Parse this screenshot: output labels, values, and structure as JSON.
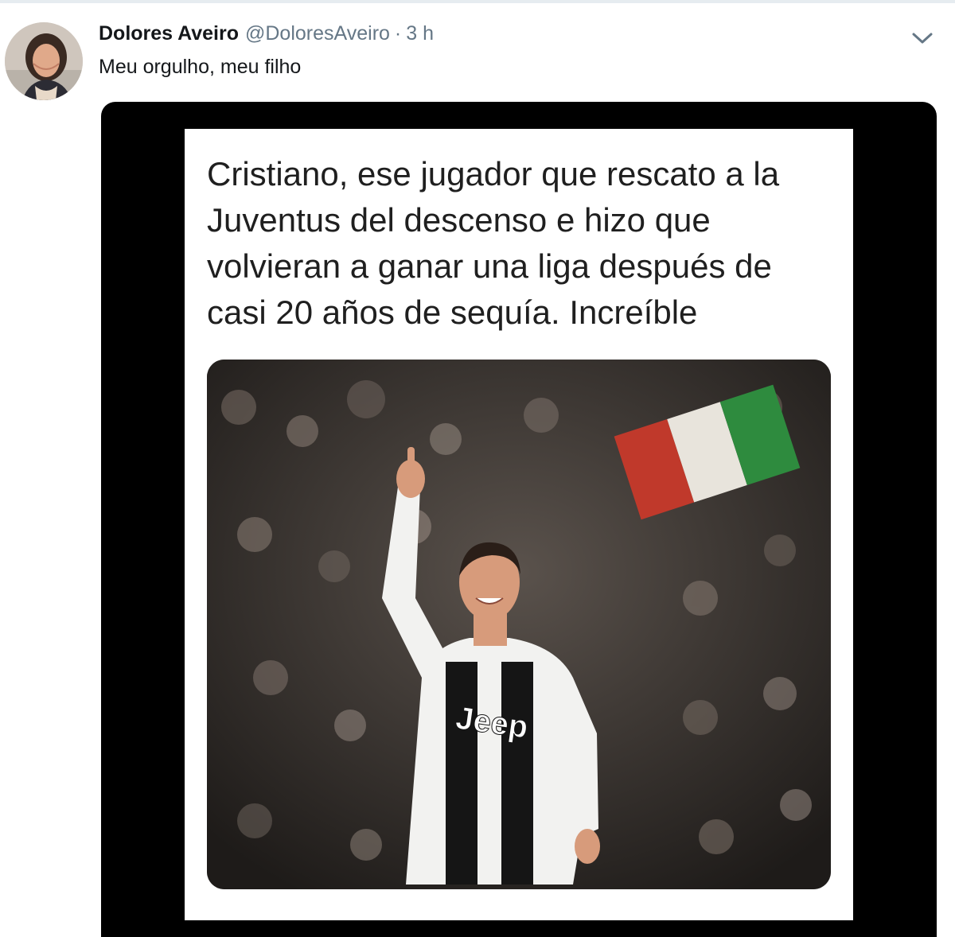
{
  "tweet": {
    "author_name": "Dolores Aveiro",
    "handle": "@DoloresAveiro",
    "separator": "·",
    "time": "3 h",
    "text": "Meu orgulho, meu filho",
    "menu_icon": "chevron-down-icon"
  },
  "media": {
    "caption": "Cristiano, ese jugador que rescato a la Juventus del descenso e hizo que volvieran a ganar una liga después de casi 20 años de sequía. Increíble",
    "photo_jersey_text": "Jeep"
  },
  "colors": {
    "text_primary": "#14171a",
    "text_secondary": "#657786",
    "media_frame": "#000000"
  }
}
